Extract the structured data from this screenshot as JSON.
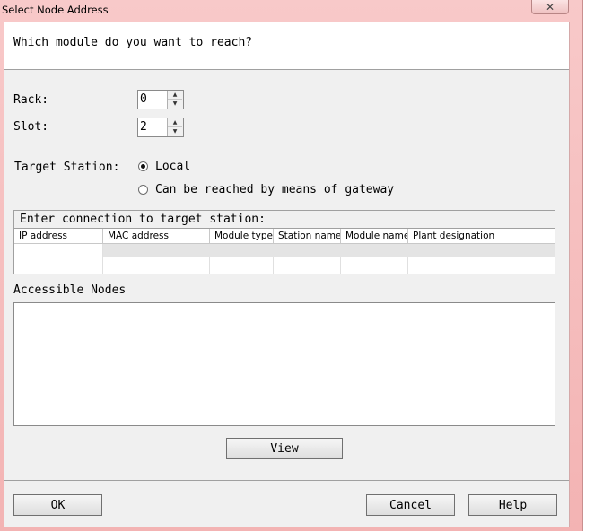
{
  "window": {
    "title": "Select Node Address",
    "close_glyph": "✕"
  },
  "header": {
    "question": "Which module do you want to reach?"
  },
  "rack": {
    "label": "Rack:",
    "value": "0"
  },
  "slot": {
    "label": "Slot:",
    "value": "2"
  },
  "target_station": {
    "label": "Target Station:",
    "options": [
      {
        "label": "Local",
        "checked": true
      },
      {
        "label": "Can be reached by means of gateway",
        "checked": false
      }
    ]
  },
  "connection": {
    "title": "Enter connection to target station:",
    "columns": [
      "IP address",
      "MAC address",
      "Module type",
      "Station name",
      "Module name",
      "Plant designation"
    ]
  },
  "accessible_nodes": {
    "label": "Accessible Nodes"
  },
  "buttons": {
    "view": "View",
    "ok": "OK",
    "cancel": "Cancel",
    "help": "Help"
  },
  "colors": {
    "title_bar": "#f3b3b3",
    "dialog_bg": "#f0f0f0"
  }
}
